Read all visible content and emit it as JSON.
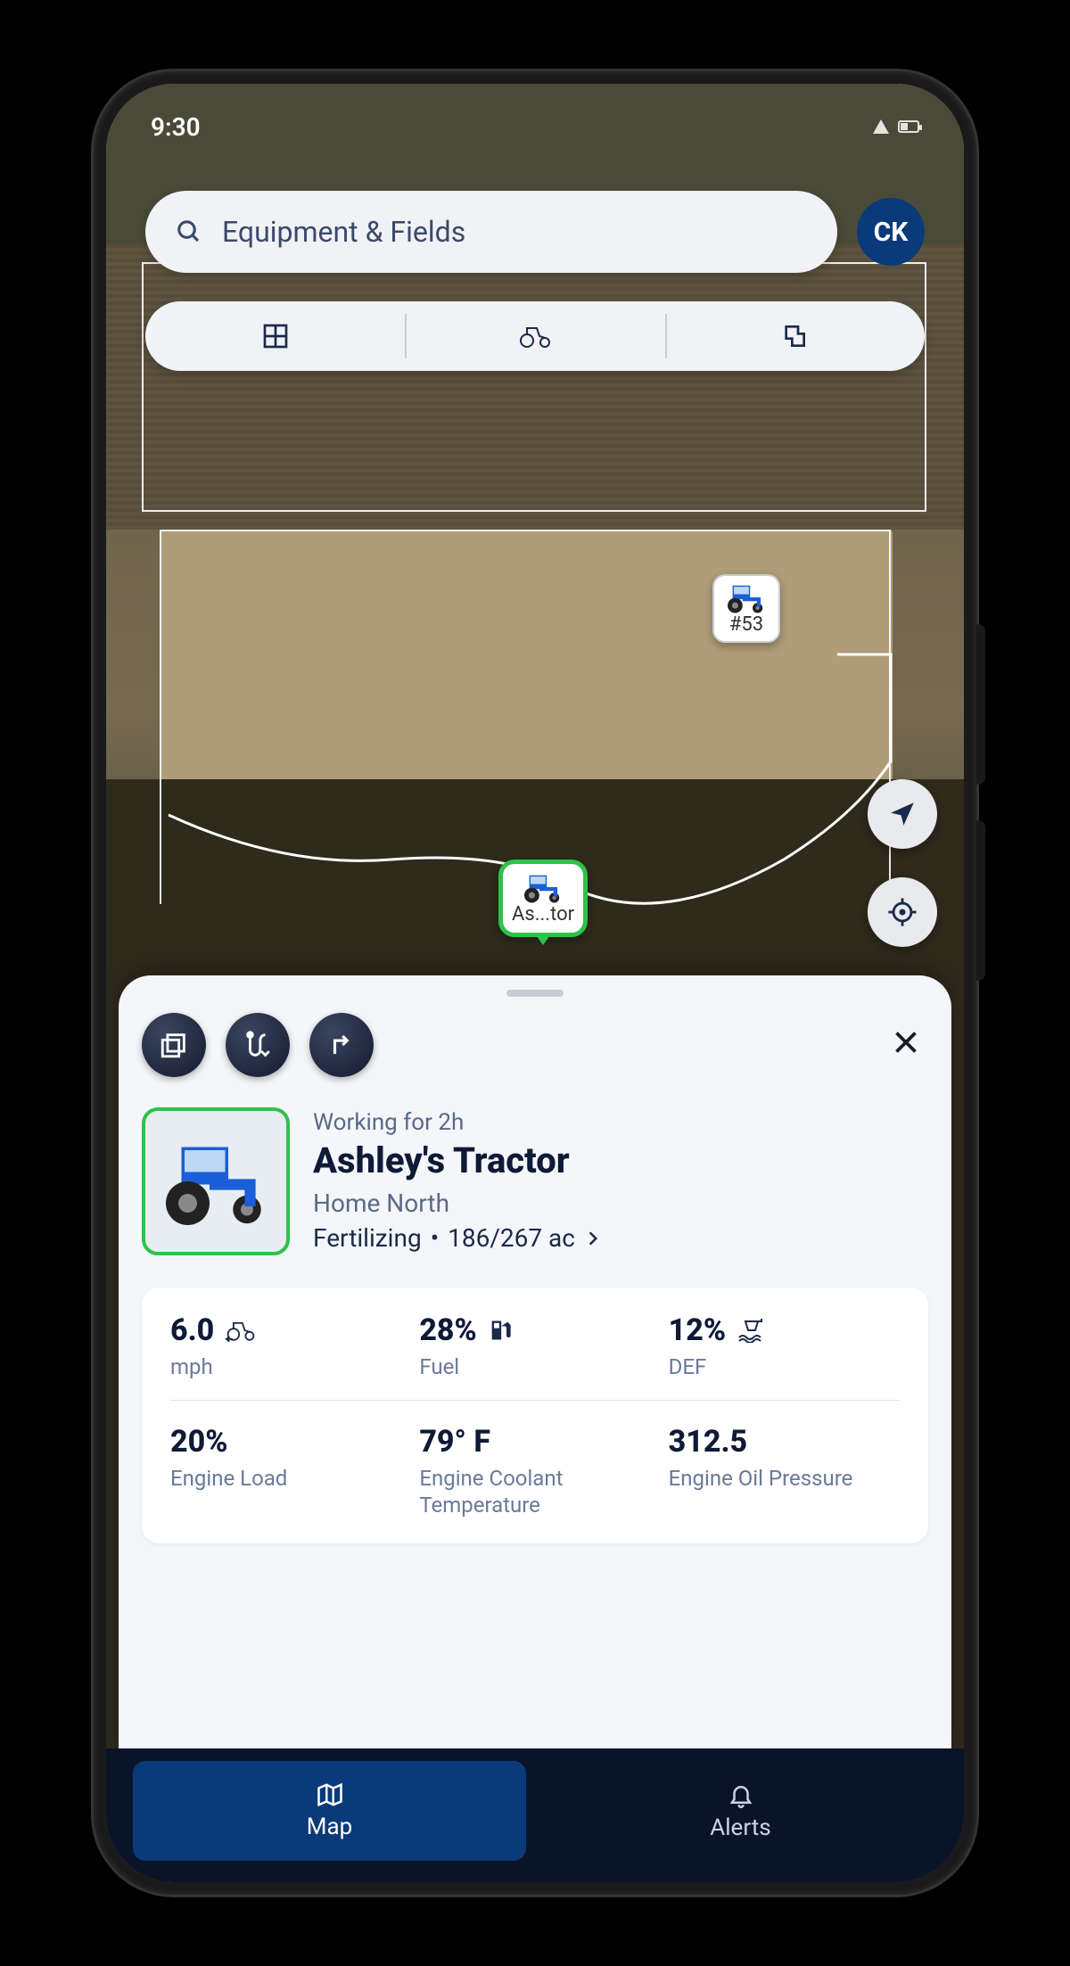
{
  "status_bar": {
    "time": "9:30"
  },
  "search": {
    "placeholder": "Equipment & Fields"
  },
  "user": {
    "initials": "CK"
  },
  "map": {
    "markers": [
      {
        "label": "#53"
      },
      {
        "label": "As...tor"
      }
    ]
  },
  "sheet": {
    "working_status": "Working for 2h",
    "equipment_name": "Ashley's Tractor",
    "field_name": "Home North",
    "task_type": "Fertilizing",
    "task_progress": "186/267 ac",
    "task_separator": "•",
    "metrics": {
      "speed": {
        "value": "6.0",
        "label": "mph"
      },
      "fuel": {
        "value": "28%",
        "label": "Fuel"
      },
      "def": {
        "value": "12%",
        "label": "DEF"
      },
      "engine_load": {
        "value": "20%",
        "label": "Engine Load"
      },
      "coolant_temp": {
        "value": "79° F",
        "label": "Engine Coolant Temperature"
      },
      "oil_pressure": {
        "value": "312.5",
        "label": "Engine Oil Pressure"
      }
    }
  },
  "nav": {
    "map": "Map",
    "alerts": "Alerts"
  }
}
